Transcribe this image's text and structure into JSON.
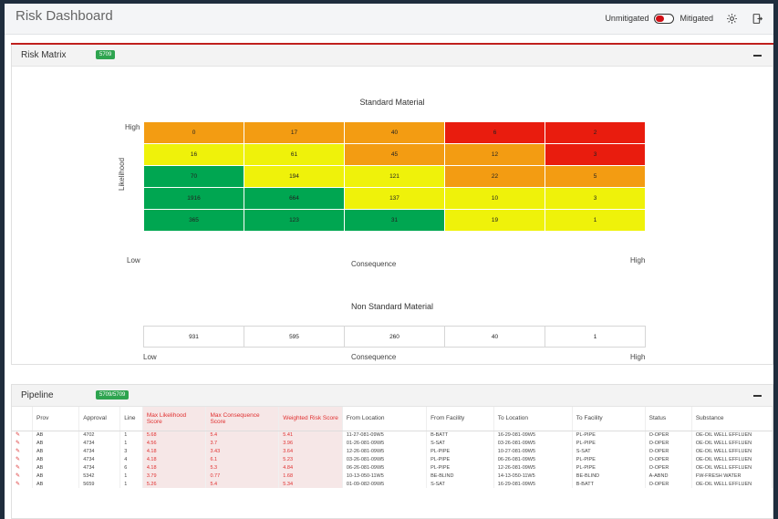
{
  "header": {
    "title": "Risk Dashboard",
    "toggle_left": "Unmitigated",
    "toggle_right": "Mitigated",
    "settings_icon": "gear-icon",
    "export_icon": "export-icon"
  },
  "risk_matrix": {
    "panel_title": "Risk Matrix",
    "badge": "5709",
    "standard_title": "Standard Material",
    "likelihood_label": "Likelihood",
    "high_label": "High",
    "low_label": "Low",
    "consequence_label": "Consequence",
    "rows": [
      [
        "0",
        "17",
        "40",
        "6",
        "2"
      ],
      [
        "16",
        "61",
        "45",
        "12",
        "3"
      ],
      [
        "70",
        "194",
        "121",
        "22",
        "5"
      ],
      [
        "1916",
        "664",
        "137",
        "10",
        "3"
      ],
      [
        "365",
        "123",
        "31",
        "19",
        "1"
      ]
    ],
    "colors": [
      [
        "#f39c12",
        "#f39c12",
        "#f39c12",
        "#e91c0e",
        "#e91c0e"
      ],
      [
        "#eff20a",
        "#eff20a",
        "#f39c12",
        "#f39c12",
        "#e91c0e"
      ],
      [
        "#00a651",
        "#eff20a",
        "#eff20a",
        "#f39c12",
        "#f39c12"
      ],
      [
        "#00a651",
        "#00a651",
        "#eff20a",
        "#eff20a",
        "#eff20a"
      ],
      [
        "#00a651",
        "#00a651",
        "#00a651",
        "#eff20a",
        "#eff20a"
      ]
    ],
    "non_standard_title": "Non Standard Material",
    "non_standard_values": [
      "931",
      "595",
      "260",
      "40",
      "1"
    ]
  },
  "pipeline": {
    "panel_title": "Pipeline",
    "badge": "5709/5709",
    "columns": [
      "",
      "Prov",
      "Approval",
      "Line",
      "Max Likelihood Score",
      "Max Consequence Score",
      "Weighted Risk Score",
      "From Location",
      "From Facility",
      "To Location",
      "To Facility",
      "Status",
      "Substance"
    ],
    "rows": [
      [
        "AB",
        "4702",
        "1",
        "5.68",
        "5.4",
        "5.41",
        "11-27-081-09W5",
        "B-BATT",
        "16-29-081-09W5",
        "PL-PIPE",
        "O-OPER",
        "OE-OIL WELL EFFLUEN"
      ],
      [
        "AB",
        "4734",
        "1",
        "4.56",
        "3.7",
        "3.96",
        "01-26-081-09W5",
        "S-SAT",
        "03-26-081-09W5",
        "PL-PIPE",
        "O-OPER",
        "OE-OIL WELL EFFLUEN"
      ],
      [
        "AB",
        "4734",
        "3",
        "4.18",
        "3.43",
        "3.64",
        "12-26-081-09W5",
        "PL-PIPE",
        "10-27-081-09W5",
        "S-SAT",
        "O-OPER",
        "OE-OIL WELL EFFLUEN"
      ],
      [
        "AB",
        "4734",
        "4",
        "4.18",
        "6.1",
        "5.23",
        "03-26-081-09W5",
        "PL-PIPE",
        "06-26-081-09W5",
        "PL-PIPE",
        "O-OPER",
        "OE-OIL WELL EFFLUEN"
      ],
      [
        "AB",
        "4734",
        "6",
        "4.18",
        "5.3",
        "4.84",
        "06-26-081-09W5",
        "PL-PIPE",
        "12-26-081-09W5",
        "PL-PIPE",
        "O-OPER",
        "OE-OIL WELL EFFLUEN"
      ],
      [
        "AB",
        "5342",
        "1",
        "3.79",
        "0.77",
        "1.68",
        "10-13-050-11W5",
        "BE-BLIND",
        "14-13-050-11W5",
        "BE-BLIND",
        "A-ABND",
        "FW-FRESH WATER"
      ],
      [
        "AB",
        "5659",
        "1",
        "5.26",
        "5.4",
        "5.34",
        "01-09-082-09W5",
        "S-SAT",
        "16-29-081-09W5",
        "B-BATT",
        "O-OPER",
        "OE-OIL WELL EFFLUEN"
      ]
    ]
  }
}
